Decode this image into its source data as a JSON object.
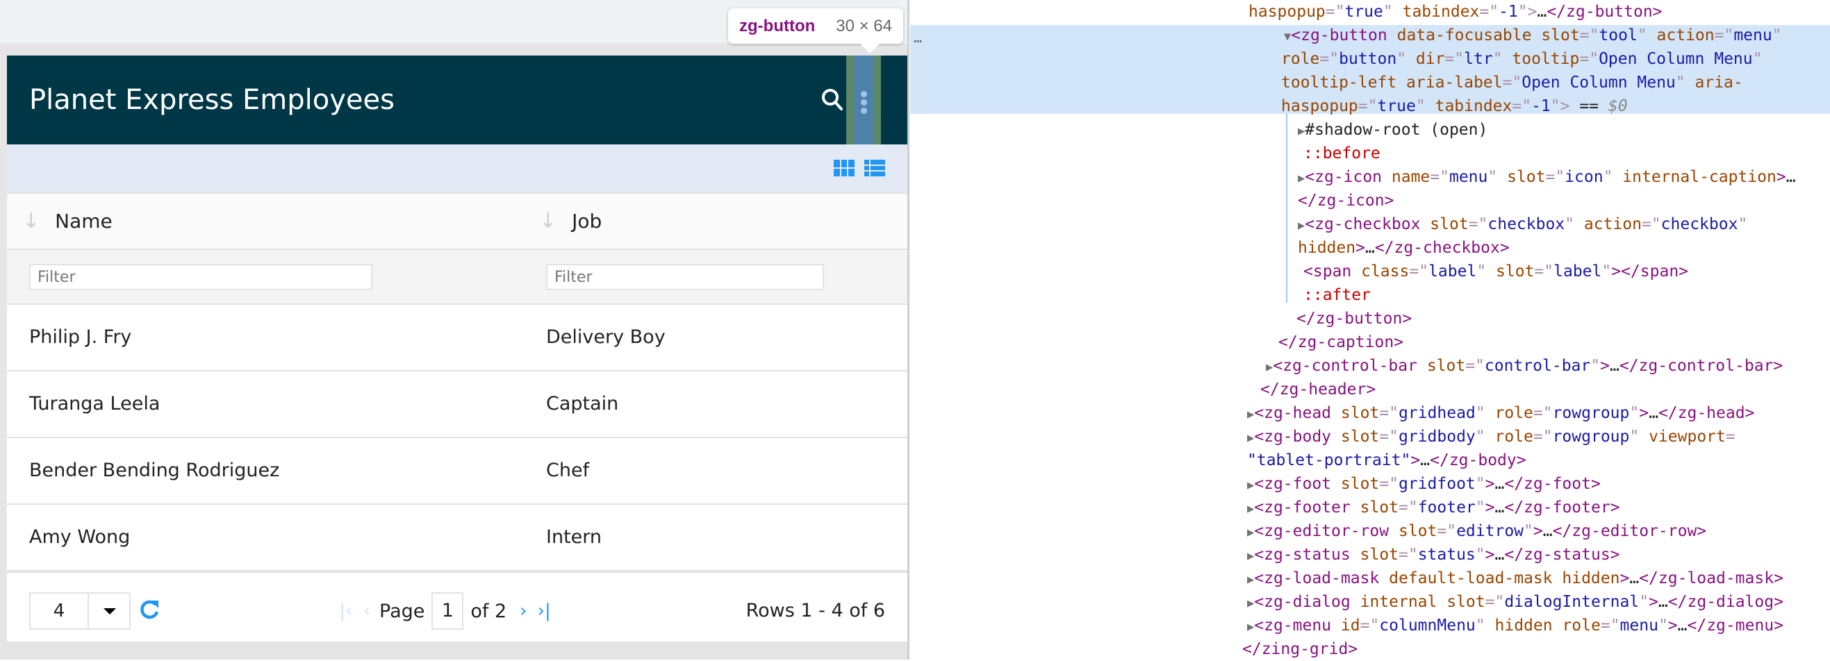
{
  "tooltip": {
    "tag": "zg-button",
    "dims": "30 × 64"
  },
  "grid": {
    "title": "Planet Express Employees",
    "colors": {
      "caption_bg": "#003747",
      "accent": "#2196f3",
      "controlbar_bg": "#e3eaf5"
    },
    "caption_icons": [
      "search-icon",
      "menu-icon"
    ],
    "controlbar_icons": [
      "grid-view-icon",
      "list-view-icon"
    ],
    "columns": [
      {
        "label": "Name",
        "filter_placeholder": "Filter"
      },
      {
        "label": "Job",
        "filter_placeholder": "Filter"
      }
    ],
    "rows": [
      {
        "name": "Philip J. Fry",
        "job": "Delivery Boy"
      },
      {
        "name": "Turanga Leela",
        "job": "Captain"
      },
      {
        "name": "Bender Bending Rodriguez",
        "job": "Chef"
      },
      {
        "name": "Amy Wong",
        "job": "Intern"
      }
    ],
    "footer": {
      "page_size": "4",
      "page_label": "Page",
      "current_page": "1",
      "of_label": "of 2",
      "row_count": "Rows 1 - 4 of 6"
    }
  },
  "devtools": {
    "gutter": "…",
    "lines": [
      {
        "segs": [
          [
            "a",
            "haspopup"
          ],
          [
            "p",
            "=\""
          ],
          [
            "v",
            "true"
          ],
          [
            "p",
            "\""
          ],
          [
            "k",
            " "
          ],
          [
            "a",
            "tabindex"
          ],
          [
            "p",
            "=\""
          ],
          [
            "v",
            "-1"
          ],
          [
            "p",
            "\">"
          ],
          [
            "k",
            "…"
          ],
          [
            "t",
            "</zg-button>"
          ]
        ]
      },
      {
        "tri": "▼",
        "segs": [
          [
            "t",
            "<zg-button"
          ],
          [
            "k",
            " "
          ],
          [
            "a",
            "data-focusable"
          ],
          [
            "k",
            " "
          ],
          [
            "a",
            "slot"
          ],
          [
            "p",
            "=\""
          ],
          [
            "v",
            "tool"
          ],
          [
            "p",
            "\""
          ],
          [
            "k",
            " "
          ],
          [
            "a",
            "action"
          ],
          [
            "p",
            "=\""
          ],
          [
            "v",
            "menu"
          ],
          [
            "p",
            "\""
          ]
        ]
      },
      {
        "segs": [
          [
            "a",
            "role"
          ],
          [
            "p",
            "=\""
          ],
          [
            "v",
            "button"
          ],
          [
            "p",
            "\""
          ],
          [
            "k",
            " "
          ],
          [
            "a",
            "dir"
          ],
          [
            "p",
            "=\""
          ],
          [
            "v",
            "ltr"
          ],
          [
            "p",
            "\""
          ],
          [
            "k",
            " "
          ],
          [
            "a",
            "tooltip"
          ],
          [
            "p",
            "=\""
          ],
          [
            "v",
            "Open Column Menu"
          ],
          [
            "p",
            "\""
          ]
        ]
      },
      {
        "segs": [
          [
            "a",
            "tooltip-left"
          ],
          [
            "k",
            " "
          ],
          [
            "a",
            "aria-label"
          ],
          [
            "p",
            "=\""
          ],
          [
            "v",
            "Open Column Menu"
          ],
          [
            "p",
            "\""
          ],
          [
            "k",
            " "
          ],
          [
            "a",
            "aria-"
          ]
        ]
      },
      {
        "segs": [
          [
            "a",
            "haspopup"
          ],
          [
            "p",
            "=\""
          ],
          [
            "v",
            "true"
          ],
          [
            "p",
            "\""
          ],
          [
            "k",
            " "
          ],
          [
            "a",
            "tabindex"
          ],
          [
            "p",
            "=\""
          ],
          [
            "v",
            "-1"
          ],
          [
            "p",
            "\">"
          ],
          [
            "k",
            " == "
          ],
          [
            "g",
            "$0"
          ]
        ]
      },
      {
        "tri": "▶",
        "segs": [
          [
            "k",
            "#shadow-root (open)"
          ]
        ]
      },
      {
        "segs": [
          [
            "pe",
            "::before"
          ]
        ]
      },
      {
        "tri": "▶",
        "segs": [
          [
            "t",
            "<zg-icon"
          ],
          [
            "k",
            " "
          ],
          [
            "a",
            "name"
          ],
          [
            "p",
            "=\""
          ],
          [
            "v",
            "menu"
          ],
          [
            "p",
            "\""
          ],
          [
            "k",
            " "
          ],
          [
            "a",
            "slot"
          ],
          [
            "p",
            "=\""
          ],
          [
            "v",
            "icon"
          ],
          [
            "p",
            "\""
          ],
          [
            "k",
            " "
          ],
          [
            "a",
            "internal-caption"
          ],
          [
            "t",
            ">"
          ],
          [
            "k",
            "…"
          ]
        ]
      },
      {
        "segs": [
          [
            "t",
            "</zg-icon>"
          ]
        ]
      },
      {
        "tri": "▶",
        "segs": [
          [
            "t",
            "<zg-checkbox"
          ],
          [
            "k",
            " "
          ],
          [
            "a",
            "slot"
          ],
          [
            "p",
            "=\""
          ],
          [
            "v",
            "checkbox"
          ],
          [
            "p",
            "\""
          ],
          [
            "k",
            " "
          ],
          [
            "a",
            "action"
          ],
          [
            "p",
            "=\""
          ],
          [
            "v",
            "checkbox"
          ],
          [
            "p",
            "\""
          ]
        ]
      },
      {
        "segs": [
          [
            "a",
            "hidden"
          ],
          [
            "t",
            ">"
          ],
          [
            "k",
            "…"
          ],
          [
            "t",
            "</zg-checkbox>"
          ]
        ]
      },
      {
        "segs": [
          [
            "t",
            "<span"
          ],
          [
            "k",
            " "
          ],
          [
            "a",
            "class"
          ],
          [
            "p",
            "=\""
          ],
          [
            "v",
            "label"
          ],
          [
            "p",
            "\""
          ],
          [
            "k",
            " "
          ],
          [
            "a",
            "slot"
          ],
          [
            "p",
            "=\""
          ],
          [
            "v",
            "label"
          ],
          [
            "p",
            "\""
          ],
          [
            "t",
            "></span>"
          ]
        ]
      },
      {
        "segs": [
          [
            "pe",
            "::after"
          ]
        ]
      },
      {
        "segs": [
          [
            "t",
            "</zg-button>"
          ]
        ]
      },
      {
        "segs": [
          [
            "t",
            "</zg-caption>"
          ]
        ]
      },
      {
        "tri": "▶",
        "segs": [
          [
            "t",
            "<zg-control-bar"
          ],
          [
            "k",
            " "
          ],
          [
            "a",
            "slot"
          ],
          [
            "p",
            "=\""
          ],
          [
            "v",
            "control-bar"
          ],
          [
            "p",
            "\""
          ],
          [
            "t",
            ">"
          ],
          [
            "k",
            "…"
          ],
          [
            "t",
            "</zg-control-bar>"
          ]
        ]
      },
      {
        "segs": [
          [
            "t",
            "</zg-header>"
          ]
        ]
      },
      {
        "tri": "▶",
        "segs": [
          [
            "t",
            "<zg-head"
          ],
          [
            "k",
            " "
          ],
          [
            "a",
            "slot"
          ],
          [
            "p",
            "=\""
          ],
          [
            "v",
            "gridhead"
          ],
          [
            "p",
            "\""
          ],
          [
            "k",
            " "
          ],
          [
            "a",
            "role"
          ],
          [
            "p",
            "=\""
          ],
          [
            "v",
            "rowgroup"
          ],
          [
            "p",
            "\""
          ],
          [
            "t",
            ">"
          ],
          [
            "k",
            "…"
          ],
          [
            "t",
            "</zg-head>"
          ]
        ]
      },
      {
        "tri": "▶",
        "segs": [
          [
            "t",
            "<zg-body"
          ],
          [
            "k",
            " "
          ],
          [
            "a",
            "slot"
          ],
          [
            "p",
            "=\""
          ],
          [
            "v",
            "gridbody"
          ],
          [
            "p",
            "\""
          ],
          [
            "k",
            " "
          ],
          [
            "a",
            "role"
          ],
          [
            "p",
            "=\""
          ],
          [
            "v",
            "rowgroup"
          ],
          [
            "p",
            "\""
          ],
          [
            "k",
            " "
          ],
          [
            "a",
            "viewport"
          ],
          [
            "p",
            "="
          ]
        ]
      },
      {
        "segs": [
          [
            "v",
            "\"tablet-portrait\""
          ],
          [
            "t",
            ">"
          ],
          [
            "k",
            "…"
          ],
          [
            "t",
            "</zg-body>"
          ]
        ]
      },
      {
        "tri": "▶",
        "segs": [
          [
            "t",
            "<zg-foot"
          ],
          [
            "k",
            " "
          ],
          [
            "a",
            "slot"
          ],
          [
            "p",
            "=\""
          ],
          [
            "v",
            "gridfoot"
          ],
          [
            "p",
            "\""
          ],
          [
            "t",
            ">"
          ],
          [
            "k",
            "…"
          ],
          [
            "t",
            "</zg-foot>"
          ]
        ]
      },
      {
        "tri": "▶",
        "segs": [
          [
            "t",
            "<zg-footer"
          ],
          [
            "k",
            " "
          ],
          [
            "a",
            "slot"
          ],
          [
            "p",
            "=\""
          ],
          [
            "v",
            "footer"
          ],
          [
            "p",
            "\""
          ],
          [
            "t",
            ">"
          ],
          [
            "k",
            "…"
          ],
          [
            "t",
            "</zg-footer>"
          ]
        ]
      },
      {
        "tri": "▶",
        "segs": [
          [
            "t",
            "<zg-editor-row"
          ],
          [
            "k",
            " "
          ],
          [
            "a",
            "slot"
          ],
          [
            "p",
            "=\""
          ],
          [
            "v",
            "editrow"
          ],
          [
            "p",
            "\""
          ],
          [
            "t",
            ">"
          ],
          [
            "k",
            "…"
          ],
          [
            "t",
            "</zg-editor-row>"
          ]
        ]
      },
      {
        "tri": "▶",
        "segs": [
          [
            "t",
            "<zg-status"
          ],
          [
            "k",
            " "
          ],
          [
            "a",
            "slot"
          ],
          [
            "p",
            "=\""
          ],
          [
            "v",
            "status"
          ],
          [
            "p",
            "\""
          ],
          [
            "t",
            ">"
          ],
          [
            "k",
            "…"
          ],
          [
            "t",
            "</zg-status>"
          ]
        ]
      },
      {
        "tri": "▶",
        "segs": [
          [
            "t",
            "<zg-load-mask"
          ],
          [
            "k",
            " "
          ],
          [
            "a",
            "default-load-mask"
          ],
          [
            "k",
            " "
          ],
          [
            "a",
            "hidden"
          ],
          [
            "t",
            ">"
          ],
          [
            "k",
            "…"
          ],
          [
            "t",
            "</zg-load-mask>"
          ]
        ]
      },
      {
        "tri": "▶",
        "segs": [
          [
            "t",
            "<zg-dialog"
          ],
          [
            "k",
            " "
          ],
          [
            "a",
            "internal"
          ],
          [
            "k",
            " "
          ],
          [
            "a",
            "slot"
          ],
          [
            "p",
            "=\""
          ],
          [
            "v",
            "dialogInternal"
          ],
          [
            "p",
            "\""
          ],
          [
            "t",
            ">"
          ],
          [
            "k",
            "…"
          ],
          [
            "t",
            "</zg-dialog>"
          ]
        ]
      },
      {
        "tri": "▶",
        "segs": [
          [
            "t",
            "<zg-menu"
          ],
          [
            "k",
            " "
          ],
          [
            "a",
            "id"
          ],
          [
            "p",
            "=\""
          ],
          [
            "v",
            "columnMenu"
          ],
          [
            "p",
            "\""
          ],
          [
            "k",
            " "
          ],
          [
            "a",
            "hidden"
          ],
          [
            "k",
            " "
          ],
          [
            "a",
            "role"
          ],
          [
            "p",
            "=\""
          ],
          [
            "v",
            "menu"
          ],
          [
            "p",
            "\""
          ],
          [
            "t",
            ">"
          ],
          [
            "k",
            "…"
          ],
          [
            "t",
            "</zg-menu>"
          ]
        ]
      },
      {
        "segs": [
          [
            "t",
            "</zing-grid>"
          ]
        ]
      }
    ]
  }
}
